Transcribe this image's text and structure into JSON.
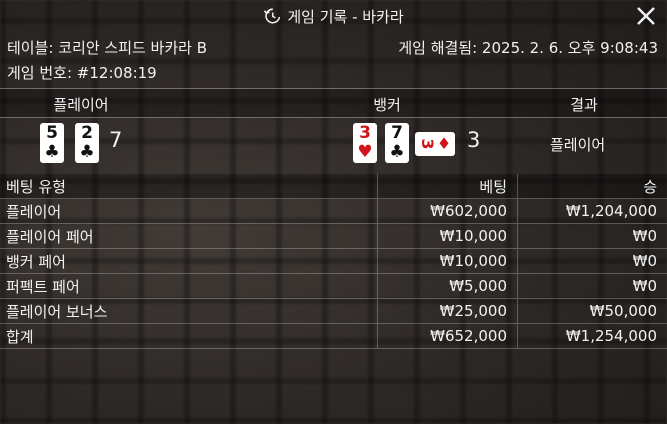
{
  "title": "게임 기록 - 바카라",
  "info": {
    "table_label": "테이블: 코리안 스피드 바카라 B",
    "resolved_label": "게임 해결됨: 2025. 2. 6. 오후 9:08:43",
    "game_number_label": "게임 번호: #12:08:19"
  },
  "columns": {
    "player": "플레이어",
    "banker": "뱅커",
    "result": "결과"
  },
  "player": {
    "cards": [
      {
        "rank": "5",
        "suit": "♣"
      },
      {
        "rank": "2",
        "suit": "♣"
      }
    ],
    "total": "7"
  },
  "banker": {
    "cards": [
      {
        "rank": "3",
        "suit": "♥"
      },
      {
        "rank": "7",
        "suit": "♣"
      }
    ],
    "side_card": {
      "rank": "3",
      "suit": "♦"
    },
    "total": "3"
  },
  "result": "플레이어",
  "bets": {
    "headers": [
      "베팅 유형",
      "베팅",
      "승"
    ],
    "rows": [
      {
        "type": "플레이어",
        "bet": "₩602,000",
        "win": "₩1,204,000"
      },
      {
        "type": "플레이어 페어",
        "bet": "₩10,000",
        "win": "₩0"
      },
      {
        "type": "뱅커 페어",
        "bet": "₩10,000",
        "win": "₩0"
      },
      {
        "type": "퍼펙트 페어",
        "bet": "₩5,000",
        "win": "₩0"
      },
      {
        "type": "플레이어 보너스",
        "bet": "₩25,000",
        "win": "₩50,000"
      },
      {
        "type": "합계",
        "bet": "₩652,000",
        "win": "₩1,254,000"
      }
    ]
  },
  "icons": {
    "history": "history-clock-icon",
    "close": "close-icon"
  },
  "colors": {
    "red_suit": "#d0141a",
    "text": "#f2f2f2"
  }
}
